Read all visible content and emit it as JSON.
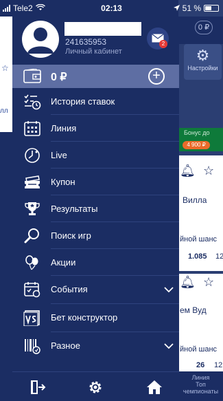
{
  "status_bar": {
    "carrier": "Tele2",
    "time": "02:13",
    "battery_percent": "51 %",
    "battery_level": 0.51
  },
  "profile": {
    "user_id": "241635953",
    "subtitle": "Личный кабинет",
    "unread_messages": "2"
  },
  "balance": {
    "amount": "0 ₽"
  },
  "menu": [
    {
      "label": "История ставок",
      "icon": "bet-history-icon"
    },
    {
      "label": "Линия",
      "icon": "calendar-grid-icon"
    },
    {
      "label": "Live",
      "icon": "live-clock-icon"
    },
    {
      "label": "Купон",
      "icon": "coupon-icon"
    },
    {
      "label": "Результаты",
      "icon": "trophy-icon"
    },
    {
      "label": "Поиск игр",
      "icon": "search-icon"
    },
    {
      "label": "Акции",
      "icon": "balloons-icon"
    },
    {
      "label": "События",
      "icon": "events-calendar-icon"
    },
    {
      "label": "Бет конструктор",
      "icon": "vs-icon"
    },
    {
      "label": "Разное",
      "icon": "barcode-icon"
    }
  ],
  "background_app": {
    "balance_chip": "0 ₽",
    "settings_label": "Настройки",
    "bonus_label": "Бонус до",
    "bonus_value": "4 900 ₽",
    "card1_name": "Вилла",
    "card1_sub": "йной шанс",
    "card1_odds": "1.085",
    "card1_odds2": "12",
    "card2_name": "ем Вуд",
    "card2_sub": "йной шанс",
    "bottom_count": "26",
    "bottom_count2": "12",
    "bottom_line1": "Линия",
    "bottom_line2": "Топ",
    "bottom_line3": "чемпионаты",
    "left_text": "лл"
  },
  "colors": {
    "drawer_bg": "#1b2d63",
    "balance_bg": "#5e6ea3",
    "badge": "#e53935"
  }
}
